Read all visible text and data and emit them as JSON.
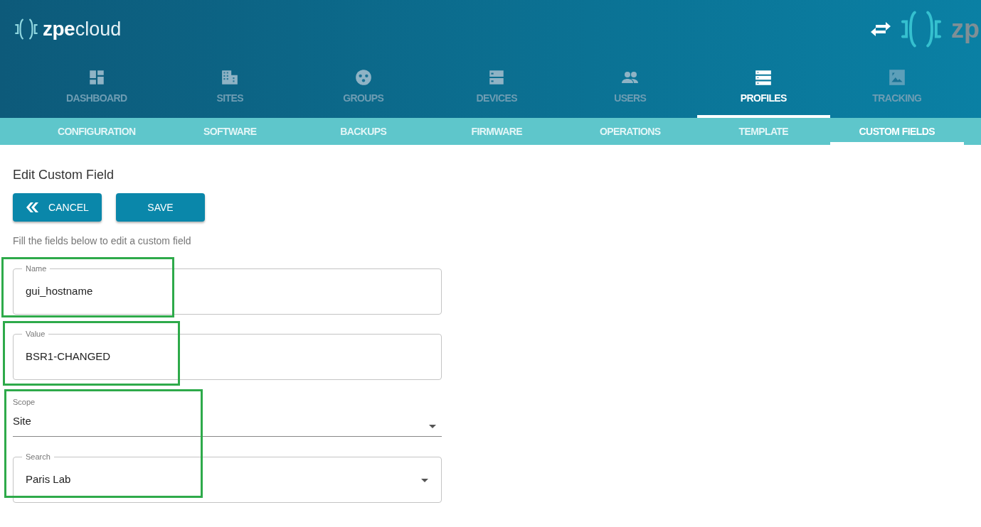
{
  "header": {
    "logo": {
      "brand": "zpe",
      "product": "cloud"
    },
    "right_logo": "zp"
  },
  "nav": [
    {
      "label": "DASHBOARD",
      "selected": false
    },
    {
      "label": "SITES",
      "selected": false
    },
    {
      "label": "GROUPS",
      "selected": false
    },
    {
      "label": "DEVICES",
      "selected": false
    },
    {
      "label": "USERS",
      "selected": false
    },
    {
      "label": "PROFILES",
      "selected": true
    },
    {
      "label": "TRACKING",
      "selected": false
    }
  ],
  "subnav": [
    {
      "label": "CONFIGURATION",
      "selected": false
    },
    {
      "label": "SOFTWARE",
      "selected": false
    },
    {
      "label": "BACKUPS",
      "selected": false
    },
    {
      "label": "FIRMWARE",
      "selected": false
    },
    {
      "label": "OPERATIONS",
      "selected": false
    },
    {
      "label": "TEMPLATE",
      "selected": false
    },
    {
      "label": "CUSTOM FIELDS",
      "selected": true
    }
  ],
  "form": {
    "title": "Edit Custom Field",
    "buttons": [
      {
        "label": "CANCEL",
        "kind": "back"
      },
      {
        "label": "SAVE",
        "kind": "plain"
      }
    ],
    "hint": "Fill the fields below to edit a custom field",
    "fields": [
      {
        "kind": "outlined",
        "label": "Name",
        "value": "gui_hostname"
      },
      {
        "kind": "outlined",
        "label": "Value",
        "value": "BSR1-CHANGED"
      },
      {
        "kind": "select",
        "label": "Scope",
        "value": "Site"
      },
      {
        "kind": "outlined-select",
        "label": "Search",
        "value": "Paris Lab"
      }
    ]
  }
}
